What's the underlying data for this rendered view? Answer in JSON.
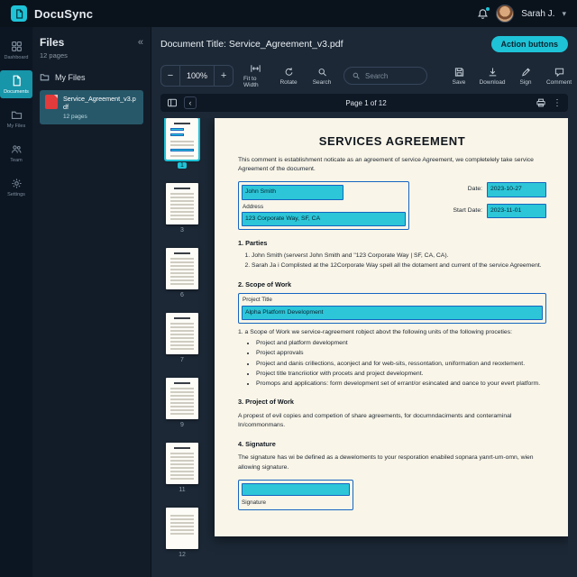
{
  "topbar": {
    "app_name": "DocuSync",
    "user_name": "Sarah J."
  },
  "icons": {
    "collapse": "«",
    "chevron_left": "‹",
    "chevron_down": "▾",
    "kebab": "⋮",
    "minus": "−",
    "plus": "+"
  },
  "nav": {
    "items": [
      {
        "label": "Dashboard"
      },
      {
        "label": "Documents"
      },
      {
        "label": "My Files"
      },
      {
        "label": "Team"
      },
      {
        "label": "Settings"
      }
    ]
  },
  "files_panel": {
    "title": "Files",
    "subtitle": "12 pages",
    "folder_label": "My Files",
    "file": {
      "name": "Service_Agreement_v3.pdf",
      "meta": "12 pages"
    }
  },
  "doc_header": {
    "title": "Document Title: Service_Agreement_v3.pdf",
    "action_button": "Action buttons"
  },
  "toolbar": {
    "zoom_value": "100%",
    "fit_to_width": "Fit to Width",
    "rotate": "Rotate",
    "search_label": "Search",
    "search_placeholder": "Search",
    "save": "Save",
    "download": "Download",
    "sign": "Sign",
    "comment": "Comment"
  },
  "pagebar": {
    "label": "Page 1 of 12"
  },
  "thumbnails": [
    {
      "num": "1"
    },
    {
      "num": "3"
    },
    {
      "num": "6"
    },
    {
      "num": "7"
    },
    {
      "num": "9"
    },
    {
      "num": "11"
    },
    {
      "num": "12"
    }
  ],
  "document": {
    "title": "SERVICES AGREEMENT",
    "intro": "This comment is establishment noticate as an agreement of service  Agreement, we completelely take service Agreement of the document.",
    "name_field": "John Smith",
    "address_label": "Address",
    "address_field": "123 Corporate Way, SF, CA",
    "date_label": "Date:",
    "date_field": "2023-10-27",
    "start_date_label": "Start Date:",
    "start_date_field": "2023-11-01",
    "s1_title": "1. Parties",
    "s1_items": [
      "John Smith (serverst John Smith and \"123 Corporate Way | SF, CA, CA).",
      "Sarah Ja i Complisted at the 12Corporate Way spell all the dotament and current of the service Agreement."
    ],
    "s2_title": "2. Scope of Work",
    "project_title_label": "Project Title",
    "project_title_field": "Alpha Platform Development",
    "s2_para": "1. a Scope of Work we service-ragreement robject abovt the following units of the following proceties:",
    "s2_bullets": [
      "Project and platform development",
      "Project approvals",
      "Project and danis crillections, aconject and for web-sits, ressontation, uniformation and reoxtement.",
      "Project title trancriiotior with procets and project development.",
      "Promops and applications: form development set of errant/or esincated and oance to your evert platform."
    ],
    "s3_title": "3. Project of Work",
    "s3_para": "A propest of evil copies and competion of share agreements, for documndaciments and conteraminal In/commonmans.",
    "s4_title": "4. Signature",
    "s4_para": "The signature has wi be defined as a deweloments to your resporation enabiled sopnara yanrt-um-omn, wien allowing signature.",
    "signature_label": "Signature"
  },
  "colors": {
    "accent": "#1fc3d7",
    "field_bg": "#2cc6d8",
    "field_border": "#1565c0",
    "page_bg": "#f9f5e8"
  }
}
